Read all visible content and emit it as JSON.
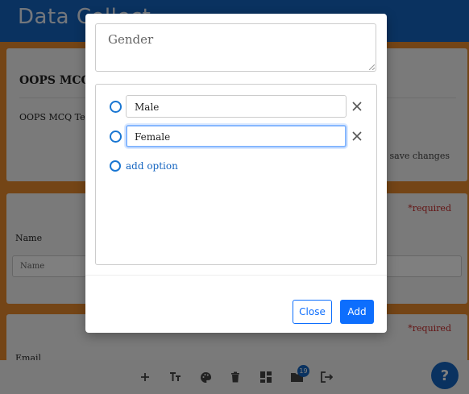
{
  "app": {
    "title": "Data Collect",
    "form_title": "OOPS MCQ",
    "form_description": "OOPS MCQ Test.",
    "save_changes": "save changes"
  },
  "questions": [
    {
      "label": "Name",
      "placeholder": "Name",
      "required": "*required"
    },
    {
      "label": "Email",
      "required": "*required"
    }
  ],
  "toolbar": {
    "icons": [
      "plus-icon",
      "text-format-icon",
      "palette-icon",
      "trash-icon",
      "dashboard-icon",
      "folder-icon",
      "logout-icon"
    ],
    "badge_count": "19",
    "help_label": "?"
  },
  "modal": {
    "question_value": "Gender",
    "options": [
      {
        "value": "Male"
      },
      {
        "value": "Female"
      }
    ],
    "add_option_label": "add option",
    "close_label": "Close",
    "add_label": "Add"
  },
  "colors": {
    "header_blue": "#1565c0",
    "background_orange": "#e98a2c",
    "primary": "#0d6efd",
    "required_red": "#c62828"
  }
}
